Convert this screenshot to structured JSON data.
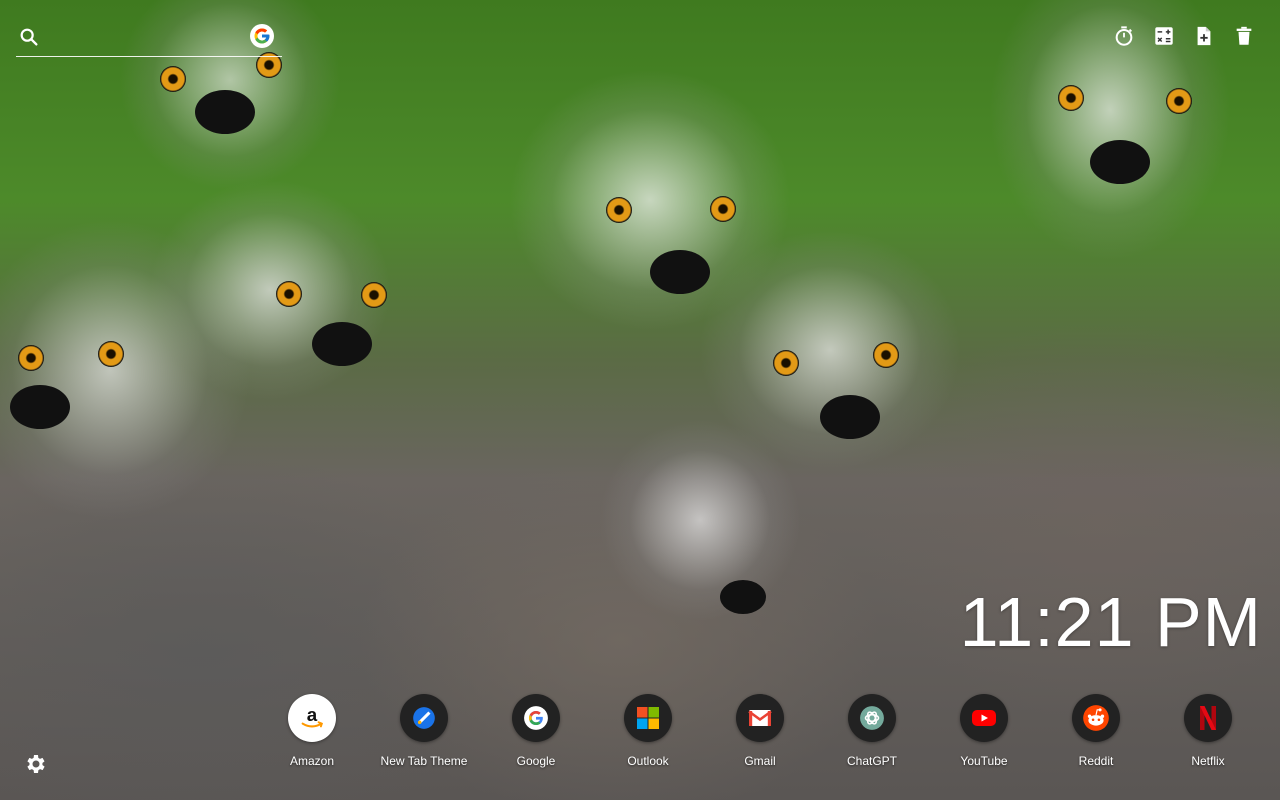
{
  "search": {
    "placeholder": "",
    "engine_icon": "google-icon"
  },
  "toolbar": [
    {
      "name": "timer-icon"
    },
    {
      "name": "calculator-icon"
    },
    {
      "name": "new-note-icon"
    },
    {
      "name": "trash-icon"
    }
  ],
  "clock": {
    "time": "11:21 PM"
  },
  "shortcuts": [
    {
      "label": "Amazon",
      "icon": "amazon-icon",
      "bg": "#ffffff"
    },
    {
      "label": "New Tab Theme",
      "icon": "new-tab-theme-icon",
      "bg": "#1e1e1e"
    },
    {
      "label": "Google",
      "icon": "google-icon",
      "bg": "#1e1e1e"
    },
    {
      "label": "Outlook",
      "icon": "microsoft-icon",
      "bg": "#1e1e1e"
    },
    {
      "label": "Gmail",
      "icon": "gmail-icon",
      "bg": "#1e1e1e"
    },
    {
      "label": "ChatGPT",
      "icon": "chatgpt-icon",
      "bg": "#1e1e1e"
    },
    {
      "label": "YouTube",
      "icon": "youtube-icon",
      "bg": "#1e1e1e"
    },
    {
      "label": "Reddit",
      "icon": "reddit-icon",
      "bg": "#1e1e1e"
    },
    {
      "label": "Netflix",
      "icon": "netflix-icon",
      "bg": "#1e1e1e"
    }
  ],
  "settings": {
    "icon": "settings-icon"
  },
  "colors": {
    "youtube": "#ff0000",
    "reddit": "#ff4500",
    "netflix": "#e50914",
    "gmail_red": "#ea4335",
    "new_tab_blue": "#1a73e8"
  }
}
